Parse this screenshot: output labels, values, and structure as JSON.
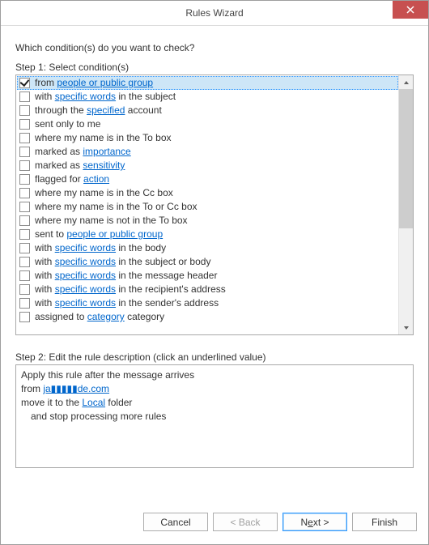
{
  "window": {
    "title": "Rules Wizard"
  },
  "prompt": "Which condition(s) do you want to check?",
  "step1_label": "Step 1: Select condition(s)",
  "conditions": [
    {
      "checked": true,
      "selected": true,
      "parts": [
        {
          "t": "from "
        },
        {
          "t": "people or public group",
          "link": true
        }
      ]
    },
    {
      "checked": false,
      "selected": false,
      "parts": [
        {
          "t": "with "
        },
        {
          "t": "specific words",
          "link": true
        },
        {
          "t": " in the subject"
        }
      ]
    },
    {
      "checked": false,
      "selected": false,
      "parts": [
        {
          "t": "through the "
        },
        {
          "t": "specified",
          "link": true
        },
        {
          "t": " account"
        }
      ]
    },
    {
      "checked": false,
      "selected": false,
      "parts": [
        {
          "t": "sent only to me"
        }
      ]
    },
    {
      "checked": false,
      "selected": false,
      "parts": [
        {
          "t": "where my name is in the To box"
        }
      ]
    },
    {
      "checked": false,
      "selected": false,
      "parts": [
        {
          "t": "marked as "
        },
        {
          "t": "importance",
          "link": true
        }
      ]
    },
    {
      "checked": false,
      "selected": false,
      "parts": [
        {
          "t": "marked as "
        },
        {
          "t": "sensitivity",
          "link": true
        }
      ]
    },
    {
      "checked": false,
      "selected": false,
      "parts": [
        {
          "t": "flagged for "
        },
        {
          "t": "action",
          "link": true
        }
      ]
    },
    {
      "checked": false,
      "selected": false,
      "parts": [
        {
          "t": "where my name is in the Cc box"
        }
      ]
    },
    {
      "checked": false,
      "selected": false,
      "parts": [
        {
          "t": "where my name is in the To or Cc box"
        }
      ]
    },
    {
      "checked": false,
      "selected": false,
      "parts": [
        {
          "t": "where my name is not in the To box"
        }
      ]
    },
    {
      "checked": false,
      "selected": false,
      "parts": [
        {
          "t": "sent to "
        },
        {
          "t": "people or public group",
          "link": true
        }
      ]
    },
    {
      "checked": false,
      "selected": false,
      "parts": [
        {
          "t": "with "
        },
        {
          "t": "specific words",
          "link": true
        },
        {
          "t": " in the body"
        }
      ]
    },
    {
      "checked": false,
      "selected": false,
      "parts": [
        {
          "t": "with "
        },
        {
          "t": "specific words",
          "link": true
        },
        {
          "t": " in the subject or body"
        }
      ]
    },
    {
      "checked": false,
      "selected": false,
      "parts": [
        {
          "t": "with "
        },
        {
          "t": "specific words",
          "link": true
        },
        {
          "t": " in the message header"
        }
      ]
    },
    {
      "checked": false,
      "selected": false,
      "parts": [
        {
          "t": "with "
        },
        {
          "t": "specific words",
          "link": true
        },
        {
          "t": " in the recipient's address"
        }
      ]
    },
    {
      "checked": false,
      "selected": false,
      "parts": [
        {
          "t": "with "
        },
        {
          "t": "specific words",
          "link": true
        },
        {
          "t": " in the sender's address"
        }
      ]
    },
    {
      "checked": false,
      "selected": false,
      "parts": [
        {
          "t": "assigned to "
        },
        {
          "t": "category",
          "link": true
        },
        {
          "t": " category"
        }
      ]
    }
  ],
  "step2_label": "Step 2: Edit the rule description (click an underlined value)",
  "description": {
    "line1": "Apply this rule after the message arrives",
    "line2_pre": "from ",
    "line2_link": "ja▮▮▮▮▮de.com",
    "line3_pre": "move it to the ",
    "line3_link": "Local",
    "line3_post": " folder",
    "line4": "and stop processing more rules"
  },
  "buttons": {
    "cancel": "Cancel",
    "back": "< Back",
    "next_pre": "N",
    "next_u": "e",
    "next_post": "xt >",
    "finish": "Finish"
  }
}
